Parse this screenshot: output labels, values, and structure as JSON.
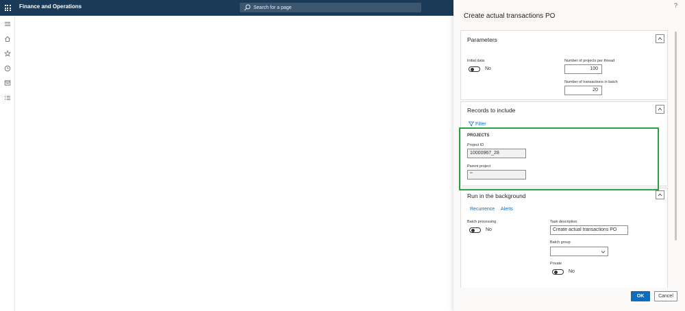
{
  "app": {
    "title": "Finance and Operations",
    "search_placeholder": "Search for a page"
  },
  "leftnav": {
    "icons": [
      "menu-icon",
      "home-icon",
      "star-icon",
      "clock-icon",
      "workspace-icon",
      "list-icon"
    ]
  },
  "dialog": {
    "title": "Create actual transactions PO",
    "help_glyph": "?",
    "parameters": {
      "header": "Parameters",
      "initial_data_label": "Initial data",
      "initial_data_value": "No",
      "projects_per_thread_label": "Number of projects per thread",
      "projects_per_thread_value": "100",
      "transactions_in_batch_label": "Number of transactions in batch",
      "transactions_in_batch_value": "20"
    },
    "records": {
      "header": "Records to include",
      "filter_label": "Filter",
      "group_title": "PROJECTS",
      "project_id_label": "Project ID",
      "project_id_value": "10000967_28",
      "parent_project_label": "Parent project",
      "parent_project_value": "\"\""
    },
    "background": {
      "header": "Run in the background",
      "recurrence_link": "Recurrence",
      "alerts_link": "Alerts",
      "batch_processing_label": "Batch processing",
      "batch_processing_value": "No",
      "task_description_label": "Task description",
      "task_description_value": "Create actual transactions PO",
      "batch_group_label": "Batch group",
      "batch_group_value": "",
      "private_label": "Private",
      "private_value": "No"
    },
    "buttons": {
      "ok": "OK",
      "cancel": "Cancel"
    }
  },
  "colors": {
    "topbar": "#1b3a57",
    "accent": "#0f6cbd",
    "highlight": "#2ea043"
  }
}
